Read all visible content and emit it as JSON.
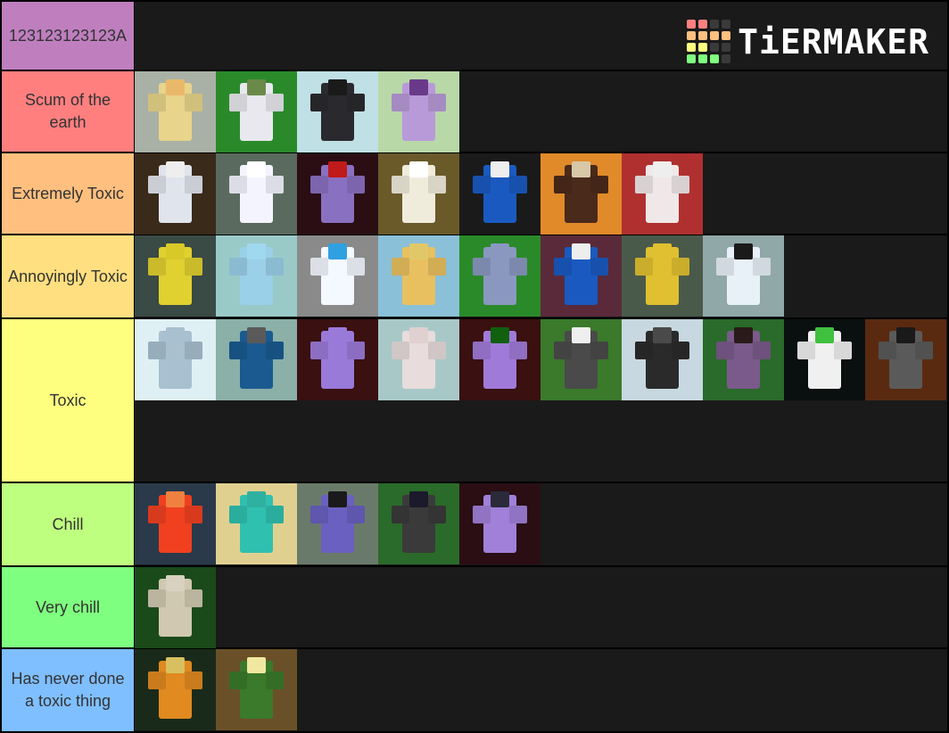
{
  "title_row": {
    "label": "123123123123A",
    "color": "#bf7fbf"
  },
  "logo": {
    "text": "TiERMAKER",
    "grid_colors": [
      "#ff7f7f",
      "#ff7f7f",
      "#3a3a3a",
      "#3a3a3a",
      "#ffbf7f",
      "#ffbf7f",
      "#ffbf7f",
      "#ffbf7f",
      "#ffff7f",
      "#ffff7f",
      "#3a3a3a",
      "#3a3a3a",
      "#7fff7f",
      "#7fff7f",
      "#7fff7f",
      "#3a3a3a"
    ]
  },
  "tiers": [
    {
      "label": "Scum of the earth",
      "color": "#ff7f7f",
      "items": [
        {
          "name": "yellow-stand-hearts",
          "bg": "#a9b1a6",
          "fig": "#e8d48a",
          "head": "#eab86a"
        },
        {
          "name": "white-horse-rider",
          "bg": "#2a8a2a",
          "fig": "#e8e8ee",
          "head": "#6b8a4a"
        },
        {
          "name": "black-stand-red-eyes",
          "bg": "#bfe0e4",
          "fig": "#2a2a2e",
          "head": "#1a1a1a"
        },
        {
          "name": "purple-checkered-stand",
          "bg": "#b8d8a8",
          "fig": "#b89ad8",
          "head": "#6a3a8a"
        }
      ]
    },
    {
      "label": "Extremely Toxic",
      "color": "#ffbf7f",
      "items": [
        {
          "name": "white-gold-stand",
          "bg": "#3a2a1a",
          "fig": "#e0e4ec",
          "head": "#eeeeee"
        },
        {
          "name": "glowing-white-stand",
          "bg": "#5a6a5e",
          "fig": "#f4f4ff",
          "head": "#ffffff"
        },
        {
          "name": "haloed-red-figure",
          "bg": "#2a0e14",
          "fig": "#8a70c0",
          "head": "#c01a1a"
        },
        {
          "name": "white-gold-golem",
          "bg": "#6a5a2a",
          "fig": "#f0ecdc",
          "head": "#ffffff"
        },
        {
          "name": "blue-shirt-noob",
          "bg": "#1a1a1a",
          "fig": "#1a5ac0",
          "head": "#eeeeee"
        },
        {
          "name": "orange-ramp-runner",
          "bg": "#e08a2a",
          "fig": "#4a2a1a",
          "head": "#d8c8a8"
        },
        {
          "name": "red-white-stand",
          "bg": "#b03030",
          "fig": "#f0e8e8",
          "head": "#eeeeee"
        }
      ]
    },
    {
      "label": "Annoyingly Toxic",
      "color": "#ffdf7f",
      "items": [
        {
          "name": "yellow-muscle-stand",
          "bg": "#3a4a44",
          "fig": "#e0d030",
          "head": "#d8c828"
        },
        {
          "name": "blue-bunny-stand",
          "bg": "#9acac8",
          "fig": "#9ad0e8",
          "head": "#a0d8f0"
        },
        {
          "name": "white-blue-stand",
          "bg": "#8a8a8a",
          "fig": "#f4f8ff",
          "head": "#30a0e0"
        },
        {
          "name": "gold-stand",
          "bg": "#8ac0d8",
          "fig": "#e8c060",
          "head": "#e0c868"
        },
        {
          "name": "revolver",
          "bg": "#2a8a2a",
          "fig": "#8a98c0",
          "head": "#8a98c0"
        },
        {
          "name": "blue-shirt-player",
          "bg": "#5a2a3a",
          "fig": "#1a5ac0",
          "head": "#eeeeee"
        },
        {
          "name": "yellow-green-stand",
          "bg": "#4a5a4a",
          "fig": "#e0c030",
          "head": "#e0c030"
        },
        {
          "name": "star-platinum-white",
          "bg": "#90a8a8",
          "fig": "#e8f0f8",
          "head": "#1a1a1a"
        }
      ]
    },
    {
      "label": "Toxic",
      "color": "#ffff7f",
      "items": [
        {
          "name": "pale-blue-stand",
          "bg": "#dff0f4",
          "fig": "#a8c0d0",
          "head": "#a8c0d0"
        },
        {
          "name": "bear-hat-player",
          "bg": "#8ab0a8",
          "fig": "#1a5a90",
          "head": "#5a5a5a"
        },
        {
          "name": "purple-small-stand",
          "bg": "#3a1010",
          "fig": "#9a7ad8",
          "head": "#9a7ad8"
        },
        {
          "name": "killer-queen",
          "bg": "#a8c8c8",
          "fig": "#e8dcdc",
          "head": "#e0d0d0"
        },
        {
          "name": "purple-glowing-eyes",
          "bg": "#3a1010",
          "fig": "#a07ad8",
          "head": "#106010"
        },
        {
          "name": "deer-antler-player-red",
          "bg": "#3a7a2a",
          "fig": "#4a4a4a",
          "head": "#eeeeee"
        },
        {
          "name": "sword-building",
          "bg": "#c8d8e0",
          "fig": "#2a2a2a",
          "head": "#4a4a4a"
        },
        {
          "name": "purple-jacket-night",
          "bg": "#2a6a2a",
          "fig": "#7a5a8a",
          "head": "#2a1a1a"
        },
        {
          "name": "green-white-stand",
          "bg": "#0a1010",
          "fig": "#f0f0f0",
          "head": "#40c040"
        },
        {
          "name": "deer-antler-player",
          "bg": "#5a2a10",
          "fig": "#5a5a5a",
          "head": "#1a1a1a"
        }
      ]
    },
    {
      "label": "Chill",
      "color": "#bfff7f",
      "items": [
        {
          "name": "fiery-red-stand",
          "bg": "#2a3a4a",
          "fig": "#f04020",
          "head": "#f08040"
        },
        {
          "name": "teal-stand",
          "bg": "#e0d090",
          "fig": "#30c0b0",
          "head": "#30b0a0"
        },
        {
          "name": "star-platinum-purple",
          "bg": "#6a7a6a",
          "fig": "#6a60c0",
          "head": "#1a1a1a"
        },
        {
          "name": "dark-gray-figure",
          "bg": "#2a6a2a",
          "fig": "#3a3a3a",
          "head": "#1a1a2a"
        },
        {
          "name": "purple-dark-stand",
          "bg": "#2a0e14",
          "fig": "#a080d8",
          "head": "#2a2a3a"
        }
      ]
    },
    {
      "label": "Very chill",
      "color": "#7fff7f",
      "items": [
        {
          "name": "shadowed-figure",
          "bg": "#1a4a1a",
          "fig": "#d0c8b0",
          "head": "#d8d0c0"
        }
      ]
    },
    {
      "label": "Has never done a toxic thing",
      "color": "#7fbfff",
      "items": [
        {
          "name": "orange-striped-stand",
          "bg": "#1a2a1a",
          "fig": "#e08a20",
          "head": "#d8c060"
        },
        {
          "name": "turtle-key",
          "bg": "#6a5028",
          "fig": "#3a7a2a",
          "head": "#f0e8a0"
        }
      ]
    }
  ]
}
